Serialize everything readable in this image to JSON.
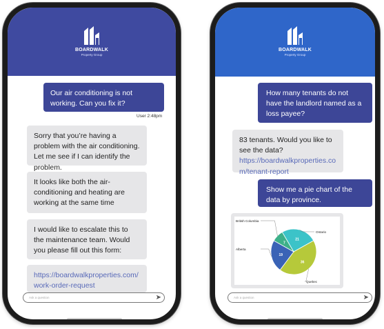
{
  "brand": {
    "name": "BOARDWALK",
    "subtitle": "Property Group"
  },
  "left_chat": {
    "user_message": "Our air conditioning is not working. Can you fix it?",
    "timestamp": "User 2:48pm",
    "bot_messages": [
      "Sorry that you’re having a problem with the air conditioning. Let me see if I can identify the problem.",
      "It looks like both the air-conditioning and heating are working at the same time",
      "I would like to escalate this to the maintenance team. Would you please fill out this form:"
    ],
    "bot_link": "https://boardwalkproperties.com/work-order-request",
    "input_placeholder": "Ask a question"
  },
  "right_chat": {
    "user_message_1": "How many tenants do not have the landlord named as a loss payee?",
    "bot_message": "83 tenants. Would you like to see the data?",
    "bot_link": "https://boardwalkproperties.com/tenant-report",
    "user_message_2": "Show me a pie chart of the data by province.",
    "input_placeholder": "Ask a question"
  },
  "colors": {
    "left_header": "#3f4aa0",
    "right_header": "#2f66c9",
    "user_bubble": "#3d4697",
    "bot_bubble": "#e6e6e8"
  },
  "icons": {
    "send": "send-arrow-icon",
    "logo": "boardwalk-building-logo-icon"
  },
  "chart_data": {
    "type": "pie",
    "title": "",
    "slices": [
      {
        "label": "Ontario",
        "value": 21,
        "color": "#3cc3c8"
      },
      {
        "label": "Quebec",
        "value": 36,
        "color": "#b6c93a"
      },
      {
        "label": "Alberta",
        "value": 19,
        "color": "#3a63b6"
      },
      {
        "label": "British Columbia",
        "value": 7,
        "color": "#3db089"
      }
    ]
  }
}
